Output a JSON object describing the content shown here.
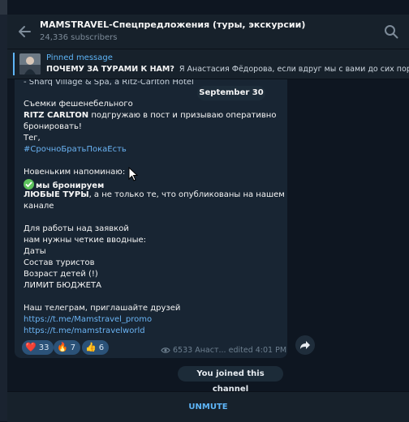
{
  "header": {
    "title": "MAMSTRAVEL-Спецпредложения (туры, экскурсии)",
    "subscribers": "24,336 subscribers"
  },
  "pinned": {
    "label": "Pinned message",
    "title": "ПОЧЕМУ ЗА ТУРАМИ К НАМ?",
    "text": "Я Анастасия Фёдорова, если вдруг мы с вами до сих пор не зна"
  },
  "message": {
    "cut_line": "- Sharq Village & Spa, а Ritz-Carlton Hotel",
    "date_badge": "September 30",
    "l1": "Съемки фешенебельного",
    "l2_bold": "RITZ CARLTON",
    "l2_rest": " подгружаю в пост и  призываю оперативно",
    "l3": "бронировать!",
    "l4": "Тег,",
    "hashtag": "#СрочноБратьПокаЕсть",
    "l5": "Новеньким напоминаю:",
    "l6_bold": "мы бронируем",
    "l7_bold": "ЛЮБЫЕ ТУРЫ",
    "l7_rest": ", а не только те, что опубликованы на нашем",
    "l8": "канале",
    "l9": "Для работы над заявкой",
    "l10": "нам нужны четкие вводные:",
    "l11": "Даты",
    "l12": "Состав туристов",
    "l13": "Возраст детей (!)",
    "l14": "ЛИМИТ БЮДЖЕТА",
    "l15": "Наш телеграм, приглашайте друзей",
    "link1": "https://t.me/Mamstravel_promo",
    "link2": "https://t.me/mamstravelworld",
    "reactions": [
      {
        "emoji": "❤️",
        "count": "33"
      },
      {
        "emoji": "🔥",
        "count": "7"
      },
      {
        "emoji": "👍",
        "count": "6"
      }
    ],
    "views": "6533",
    "author": "Анаст...",
    "edited": "edited 4:01 PM"
  },
  "service": {
    "joined": "You joined this channel"
  },
  "bottom": {
    "unmute": "UNMUTE"
  },
  "icons": {
    "back": "arrow-left-icon",
    "search": "search-icon",
    "share": "share-arrow-icon",
    "views": "eye-icon",
    "check": "check-mark-icon"
  },
  "colors": {
    "background": "#0e1621",
    "panel": "#17212b",
    "bubble": "#182533",
    "accent": "#5eb5f7",
    "link": "#6ab3f3",
    "reaction": "#2b5278"
  }
}
